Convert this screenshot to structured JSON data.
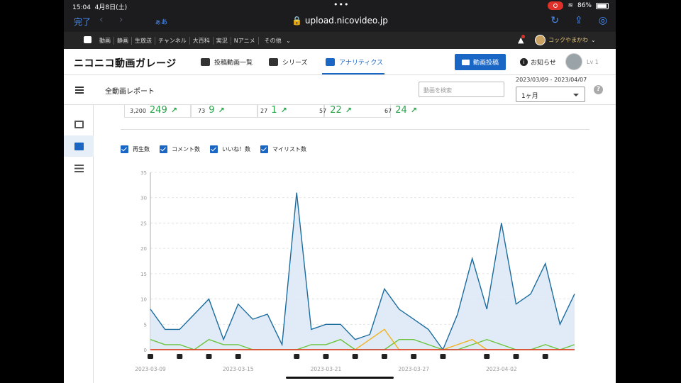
{
  "status_bar": {
    "time": "15:04",
    "date": "4月8日(土)",
    "battery": "86%"
  },
  "browser": {
    "done_label": "完了",
    "text_size_label": "ぁあ",
    "url": "upload.nicovideo.jp"
  },
  "nico_bar": {
    "links": [
      "動画",
      "静画",
      "生放送",
      "チャンネル",
      "大百科",
      "実況",
      "Nアニメ",
      "その他"
    ],
    "user_name": "コックやまかわ"
  },
  "header": {
    "logo": "ニコニコ動画ガレージ",
    "tabs": [
      {
        "label": "投稿動画一覧",
        "icon": "video-list-icon"
      },
      {
        "label": "シリーズ",
        "icon": "series-icon"
      },
      {
        "label": "アナリティクス",
        "icon": "bar-chart-icon"
      }
    ],
    "upload_label": "動画投稿",
    "notice_label": "お知らせ",
    "level_label": "Lv 1"
  },
  "subheader": {
    "title": "全動画レポート",
    "search_placeholder": "動画を検索",
    "date_range": "2023/03/09 - 2023/04/07",
    "period": "1ヶ月"
  },
  "kpis": [
    {
      "total": "3,200",
      "delta": "249"
    },
    {
      "total": "73",
      "delta": "9"
    },
    {
      "total": "27",
      "delta": "1"
    },
    {
      "total": "57",
      "delta": "22"
    },
    {
      "total": "67",
      "delta": "24"
    }
  ],
  "legend": [
    "再生数",
    "コメント数",
    "いいね！数",
    "マイリスト数"
  ],
  "chart_data": {
    "type": "line",
    "ylim": [
      0,
      35
    ],
    "y_ticks": [
      0,
      5,
      10,
      15,
      20,
      25,
      30,
      35
    ],
    "x_tick_labels": [
      "2023-03-09",
      "2023-03-15",
      "2023-03-21",
      "2023-03-27",
      "2023-04-02"
    ],
    "x_tick_indices": [
      0,
      6,
      12,
      18,
      24
    ],
    "upload_marker_days": [
      0,
      2,
      4,
      6,
      10,
      12,
      14,
      16,
      18,
      20,
      23,
      25,
      27
    ],
    "series": [
      {
        "name": "再生数",
        "color": "#1b6c9e",
        "fill": true,
        "values": [
          8,
          4,
          4,
          7,
          10,
          2,
          9,
          6,
          7,
          1,
          31,
          4,
          5,
          5,
          2,
          3,
          12,
          8,
          6,
          4,
          0,
          7,
          18,
          8,
          25,
          9,
          11,
          17,
          5,
          11
        ]
      },
      {
        "name": "コメント数",
        "color": "#6cc43e",
        "values": [
          2,
          1,
          1,
          0,
          2,
          1,
          1,
          0,
          0,
          0,
          0,
          1,
          1,
          2,
          0,
          0,
          0,
          2,
          2,
          1,
          0,
          0,
          1,
          2,
          1,
          0,
          0,
          1,
          0,
          1
        ]
      },
      {
        "name": "いいね！数",
        "color": "#f0b323",
        "values": [
          0,
          0,
          0,
          0,
          0,
          0,
          0,
          0,
          0,
          0,
          0,
          0,
          0,
          0,
          0,
          2,
          4,
          0,
          0,
          0,
          0,
          1,
          2,
          0,
          0,
          0,
          0,
          0,
          0,
          0
        ]
      },
      {
        "name": "マイリスト数",
        "color": "#d9342b",
        "values": [
          0,
          0,
          0,
          0,
          0,
          0,
          0,
          0,
          0,
          0,
          0,
          0,
          0,
          0,
          0,
          0,
          0,
          0,
          0,
          0,
          0,
          0,
          0,
          0,
          0,
          0,
          0,
          0,
          0,
          0
        ]
      }
    ]
  }
}
